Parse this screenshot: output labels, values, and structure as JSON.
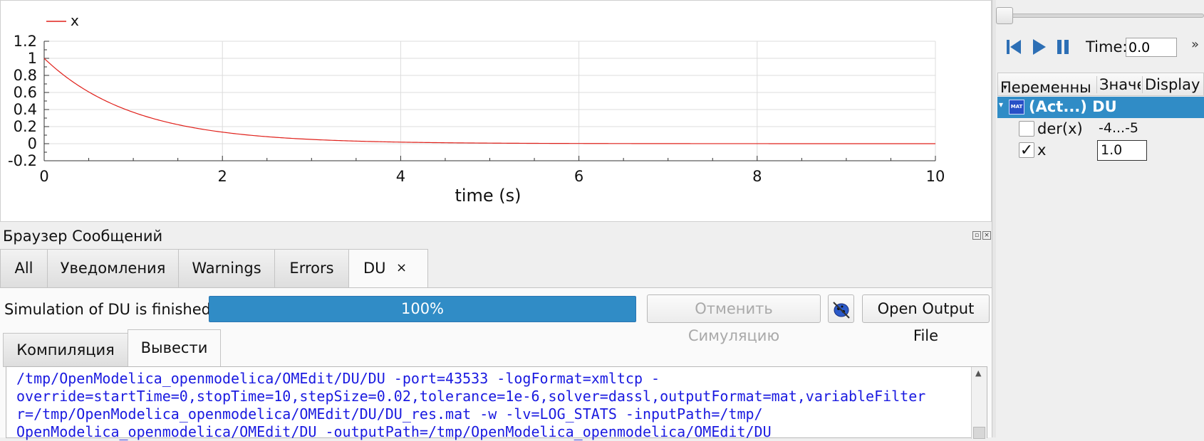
{
  "plot": {
    "legend_label": "x",
    "xlabel": "time (s)",
    "x_ticks": [
      "0",
      "2",
      "4",
      "6",
      "8",
      "10"
    ],
    "y_ticks": [
      "1.2",
      "1",
      "0.8",
      "0.6",
      "0.4",
      "0.2",
      "0",
      "-0.2"
    ],
    "line_color": "#e0201a"
  },
  "chart_data": {
    "type": "line",
    "xlabel": "time (s)",
    "xlim": [
      0,
      10
    ],
    "ylim": [
      -0.2,
      1.2
    ],
    "grid": true,
    "legend": "top-left",
    "series": [
      {
        "name": "x",
        "formula": "exp(-t)",
        "x": [
          0,
          0.5,
          1,
          1.5,
          2,
          2.5,
          3,
          4,
          5,
          6,
          7,
          8,
          9,
          10
        ],
        "y": [
          1,
          0.607,
          0.368,
          0.223,
          0.135,
          0.082,
          0.05,
          0.018,
          0.007,
          0.0025,
          0.0009,
          0.0003,
          0.0001,
          0
        ]
      }
    ]
  },
  "sim_panel": {
    "time_label": "Time:",
    "time_value": "0.0",
    "more": "»",
    "columns": {
      "variables": "Переменны",
      "value": "Значе",
      "display": "Display"
    },
    "root_item": "(Act...) DU",
    "root_icon": "MAT",
    "variables": [
      {
        "name": "der(x)",
        "value": "-4...-5",
        "checked": false
      },
      {
        "name": "x",
        "value": "1.0",
        "checked": true
      }
    ]
  },
  "messages": {
    "title": "Браузер Сообщений",
    "tabs": [
      "All",
      "Уведомления",
      "Warnings",
      "Errors",
      "DU"
    ],
    "close_symbol": "×",
    "status": "Simulation of DU is finished.",
    "progress_text": "100%",
    "progress_value": 1.0,
    "cancel_label": "Отменить Симуляцию",
    "open_output_label": "Open Output File",
    "sub_tabs": [
      "Компиляция",
      "Вывести"
    ],
    "output_lines": [
      "/tmp/OpenModelica_openmodelica/OMEdit/DU/DU -port=43533 -logFormat=xmltcp -",
      "override=startTime=0,stopTime=10,stepSize=0.02,tolerance=1e-6,solver=dassl,outputFormat=mat,variableFilter",
      "r=/tmp/OpenModelica_openmodelica/OMEdit/DU/DU_res.mat -w -lv=LOG_STATS -inputPath=/tmp/",
      "OpenModelica_openmodelica/OMEdit/DU -outputPath=/tmp/OpenModelica_openmodelica/OMEdit/DU"
    ]
  }
}
